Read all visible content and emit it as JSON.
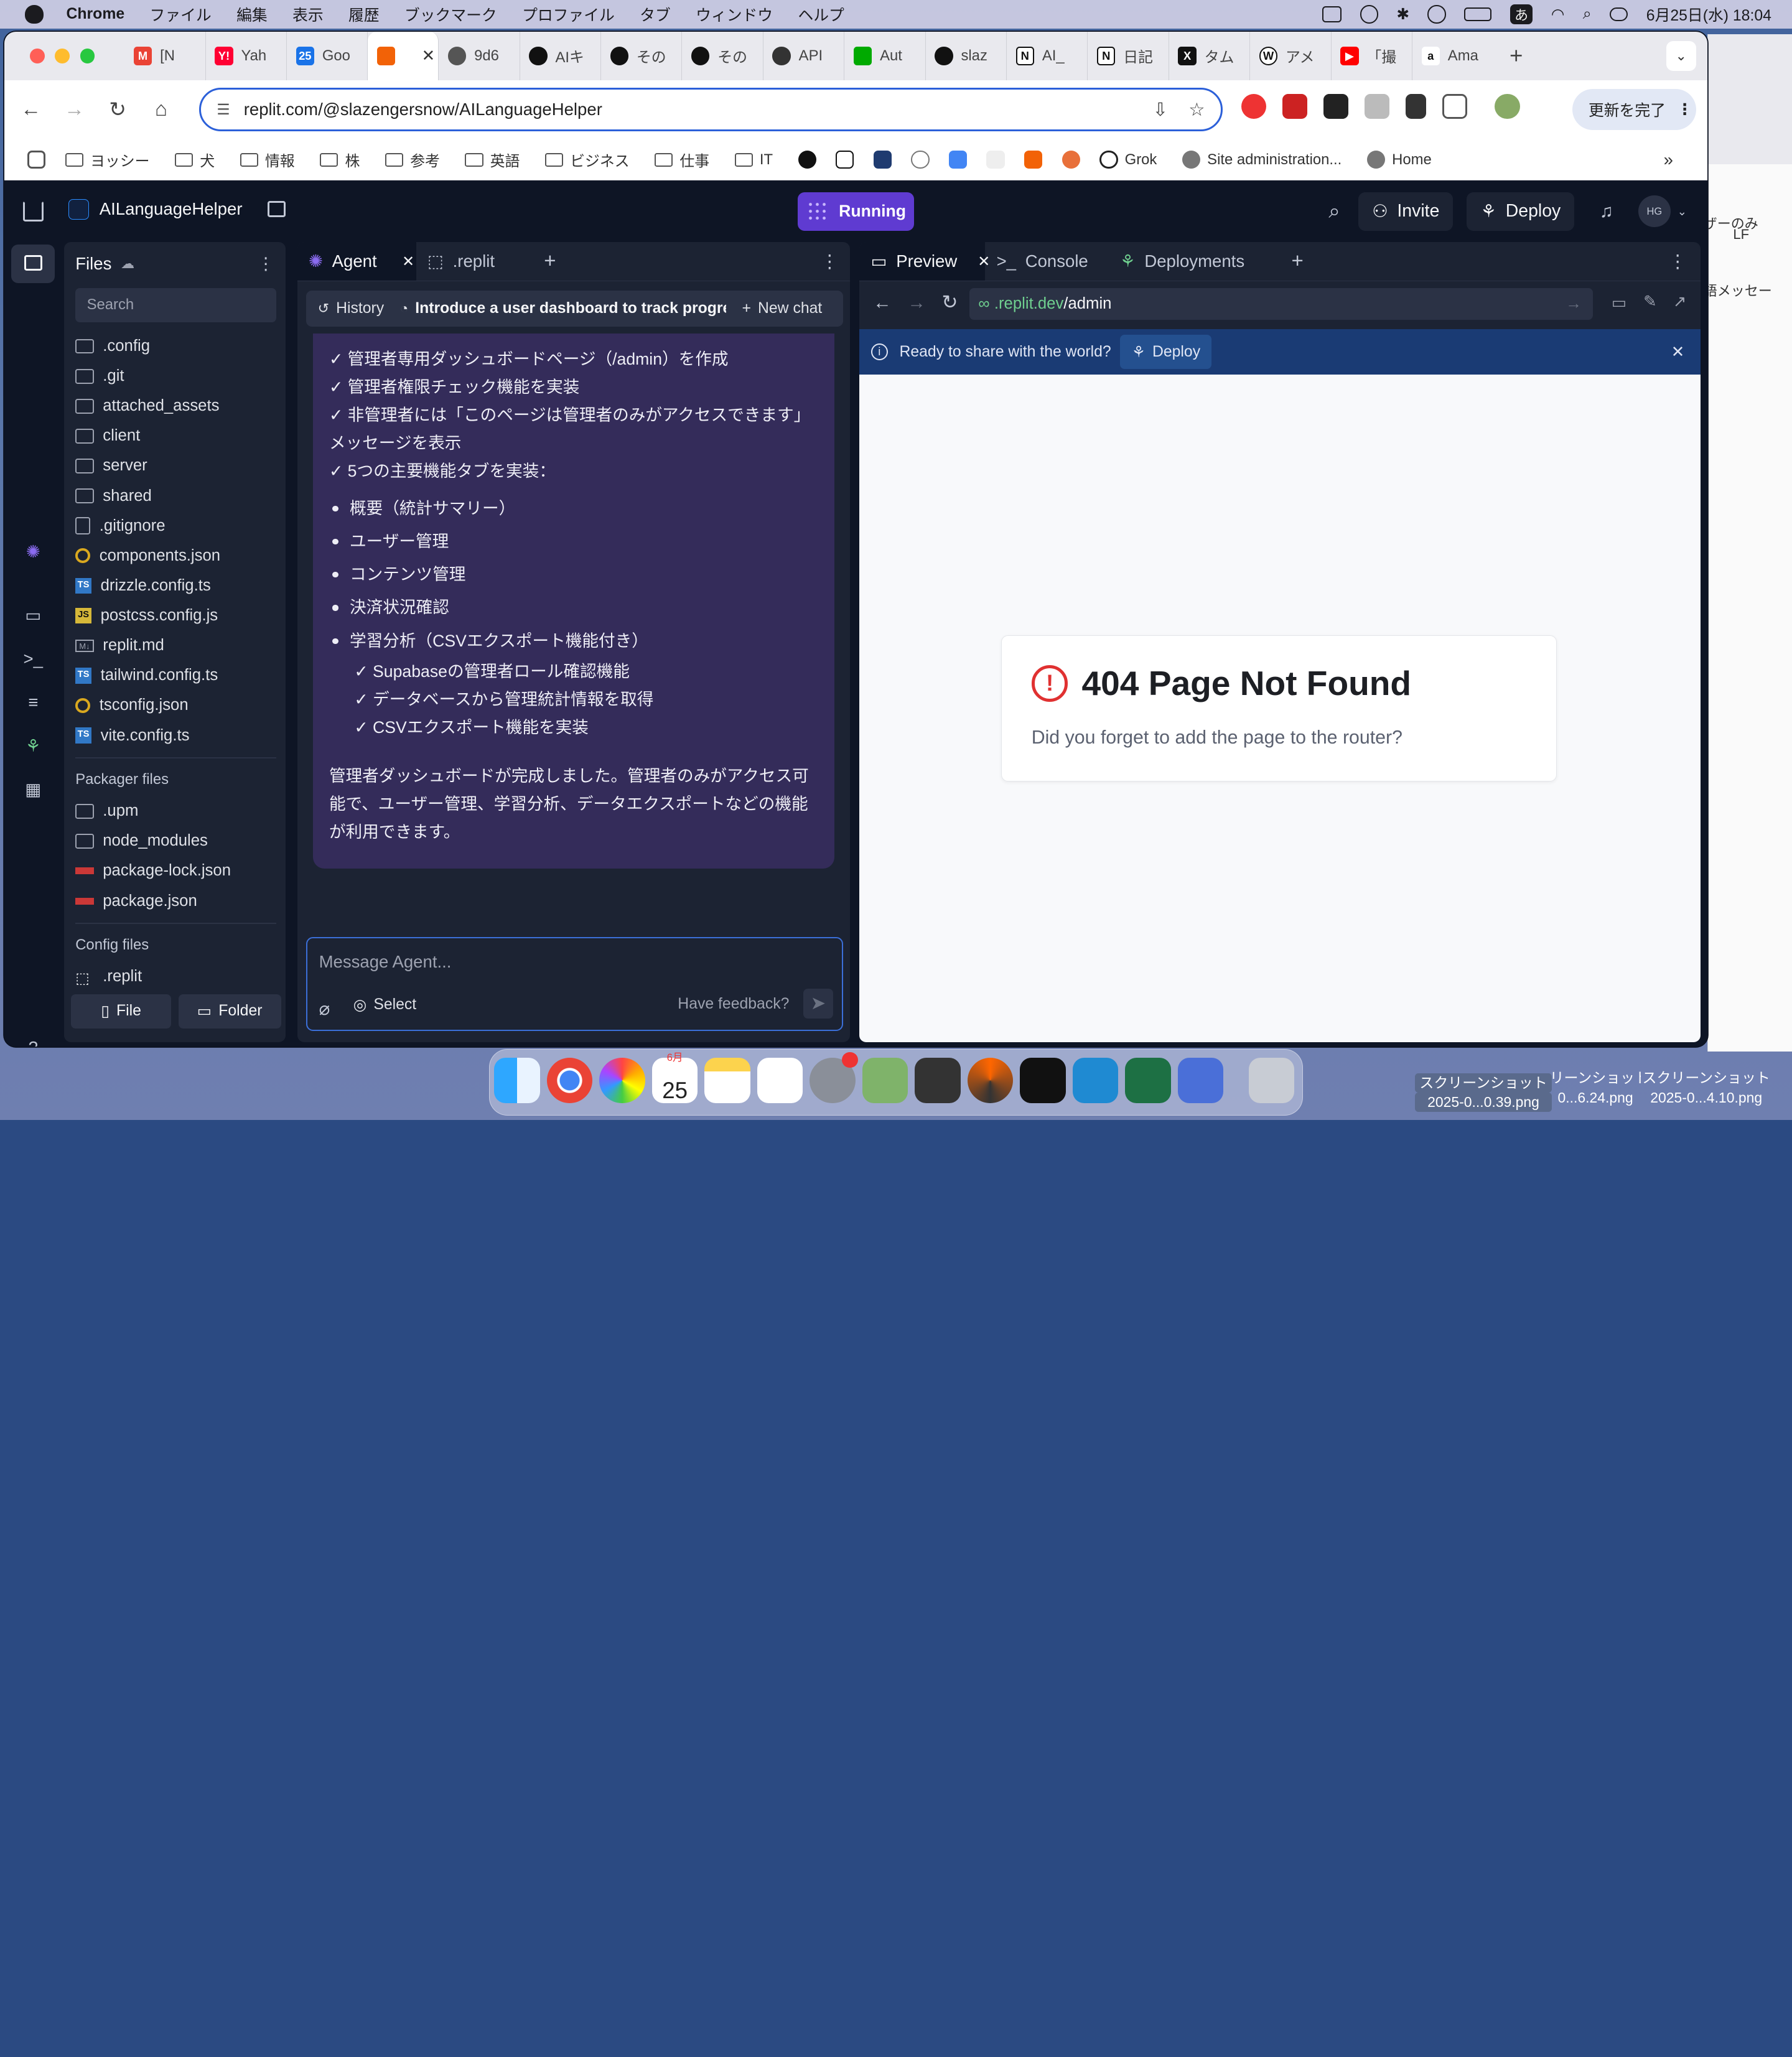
{
  "menubar": {
    "app": "Chrome",
    "items": [
      "ファイル",
      "編集",
      "表示",
      "履歴",
      "ブックマーク",
      "プロファイル",
      "タブ",
      "ウィンドウ",
      "ヘルプ"
    ],
    "ime": "あ",
    "clock": "6月25日(水)  18:04"
  },
  "tabs": [
    {
      "label": "[N",
      "color": "#ea4335",
      "glyph": "M"
    },
    {
      "label": "Yah",
      "color": "#ff0033",
      "glyph": "Y!"
    },
    {
      "label": "Goo",
      "color": "#1a73e8",
      "glyph": "25"
    },
    {
      "label": "",
      "color": "#f26207",
      "glyph": ""
    },
    {
      "label": "9d6",
      "color": "#444",
      "glyph": ""
    },
    {
      "label": "AIキ",
      "color": "#111",
      "glyph": ""
    },
    {
      "label": "その",
      "color": "#111",
      "glyph": ""
    },
    {
      "label": "その",
      "color": "#111",
      "glyph": ""
    },
    {
      "label": "API",
      "color": "#111",
      "glyph": ""
    },
    {
      "label": "Aut",
      "color": "#0b0",
      "glyph": ""
    },
    {
      "label": "slaz",
      "color": "#111",
      "glyph": ""
    },
    {
      "label": "AI_",
      "color": "#111",
      "glyph": "N"
    },
    {
      "label": "日記",
      "color": "#111",
      "glyph": "N"
    },
    {
      "label": "タム",
      "color": "#111",
      "glyph": "X"
    },
    {
      "label": "アメ",
      "color": "#fff",
      "glyph": "W"
    },
    {
      "label": "「撮",
      "color": "#ff0000",
      "glyph": "▶"
    },
    {
      "label": "Ama",
      "color": "#fff",
      "glyph": "a"
    }
  ],
  "toolbar": {
    "url": "replit.com/@slazengersnow/AILanguageHelper",
    "update_label": "更新を完了"
  },
  "bookmarks": [
    "ヨッシー",
    "犬",
    "情報",
    "株",
    "参考",
    "英語",
    "ビジネス",
    "仕事",
    "IT"
  ],
  "bookmarks2": {
    "grok": "Grok",
    "site": "Site administration...",
    "home": "Home"
  },
  "replit": {
    "project": "AILanguageHelper",
    "status": "Running",
    "invite": "Invite",
    "deploy": "Deploy",
    "avatar": "HG"
  },
  "files": {
    "title": "Files",
    "search_placeholder": "Search",
    "items": [
      {
        "name": ".config",
        "type": "folder"
      },
      {
        "name": ".git",
        "type": "folder"
      },
      {
        "name": "attached_assets",
        "type": "folder"
      },
      {
        "name": "client",
        "type": "folder"
      },
      {
        "name": "server",
        "type": "folder"
      },
      {
        "name": "shared",
        "type": "folder"
      },
      {
        "name": ".gitignore",
        "type": "file"
      },
      {
        "name": "components.json",
        "type": "ring"
      },
      {
        "name": "drizzle.config.ts",
        "type": "ts"
      },
      {
        "name": "postcss.config.js",
        "type": "js"
      },
      {
        "name": "replit.md",
        "type": "md"
      },
      {
        "name": "tailwind.config.ts",
        "type": "ts"
      },
      {
        "name": "tsconfig.json",
        "type": "ring"
      },
      {
        "name": "vite.config.ts",
        "type": "ts"
      }
    ],
    "packager_title": "Packager files",
    "packager": [
      {
        "name": ".upm",
        "type": "folder"
      },
      {
        "name": "node_modules",
        "type": "folder"
      },
      {
        "name": "package-lock.json",
        "type": "npm"
      },
      {
        "name": "package.json",
        "type": "npm"
      }
    ],
    "config_title": "Config files",
    "config": [
      {
        "name": ".replit",
        "type": "replit"
      }
    ],
    "file_btn": "File",
    "folder_btn": "Folder"
  },
  "agent": {
    "tab_agent": "Agent",
    "tab_replit": ".replit",
    "history": "History",
    "chat_title": "Introduce a user dashboard to track progre...",
    "new_chat": "New chat",
    "checks": [
      "✓ 管理者専用ダッシュボードページ（/admin）を作成",
      "✓ 管理者権限チェック機能を実装",
      "✓ 非管理者には「このページは管理者のみがアクセスできます」メッセージを表示",
      "✓ 5つの主要機能タブを実装："
    ],
    "bullets": [
      "概要（統計サマリー）",
      "ユーザー管理",
      "コンテンツ管理",
      "決済状況確認",
      "学習分析（CSVエクスポート機能付き）"
    ],
    "subchecks": [
      "✓ Supabaseの管理者ロール確認機能",
      "✓ データベースから管理統計情報を取得",
      "✓ CSVエクスポート機能を実装"
    ],
    "summary": "管理者ダッシュボードが完成しました。管理者のみがアクセス可能で、ユーザー管理、学習分析、データエクスポートなどの機能が利用できます。",
    "input_placeholder": "Message Agent...",
    "select_label": "Select",
    "feedback": "Have feedback?"
  },
  "preview": {
    "tab_preview": "Preview",
    "tab_console": "Console",
    "tab_deployments": "Deployments",
    "url_host": ".replit.dev",
    "url_path": "/admin",
    "banner_text": "Ready to share with the world?",
    "banner_deploy": "Deploy",
    "error_title": "404 Page Not Found",
    "error_sub": "Did you forget to add the page to the router?"
  },
  "desktop": {
    "side_text1": "ザーのみ",
    "side_text2": "語メッセー",
    "lf": "LF",
    "shot1_a": "スクリーンショット",
    "shot1_b": "2025-0...0.39.png",
    "shot2_a": "リーンショット",
    "shot2_b": "0...6.24.png",
    "shot3_a": "スクリーンショット",
    "shot3_b": "2025-0...4.10.png",
    "dock_cal_day": "25",
    "dock_cal_month": "6月"
  }
}
